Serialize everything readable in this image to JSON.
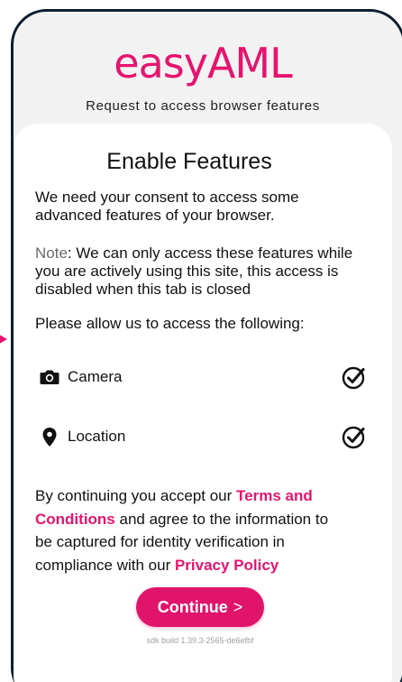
{
  "header": {
    "logo_text": "easyAML",
    "subtitle": "Request to access browser features"
  },
  "card": {
    "title": "Enable Features",
    "intro": "We need your consent to access some advanced features of your browser.",
    "note_label": "Note",
    "note_text": ": We can only access these features while you are actively using this site, this access is disabled when this tab is closed",
    "allow_prompt": "Please allow us to access the following:",
    "features": [
      {
        "label": "Camera",
        "icon": "camera-icon",
        "status": "checked"
      },
      {
        "label": "Location",
        "icon": "location-pin-icon",
        "status": "checked"
      }
    ],
    "terms": {
      "part1": "By continuing you accept our ",
      "terms_link": "Terms and Conditions",
      "part2": " and agree to the information to be captured for identity verification in compliance with our ",
      "privacy_link": "Privacy Policy"
    },
    "continue_label": "Continue",
    "continue_chevron": ">",
    "sdk_build": "sdk build 1.39.3-2565-de6efbf"
  },
  "colors": {
    "accent": "#e6146e",
    "frame": "#0f1e2e",
    "background": "#f2f2f2",
    "card": "#ffffff"
  }
}
